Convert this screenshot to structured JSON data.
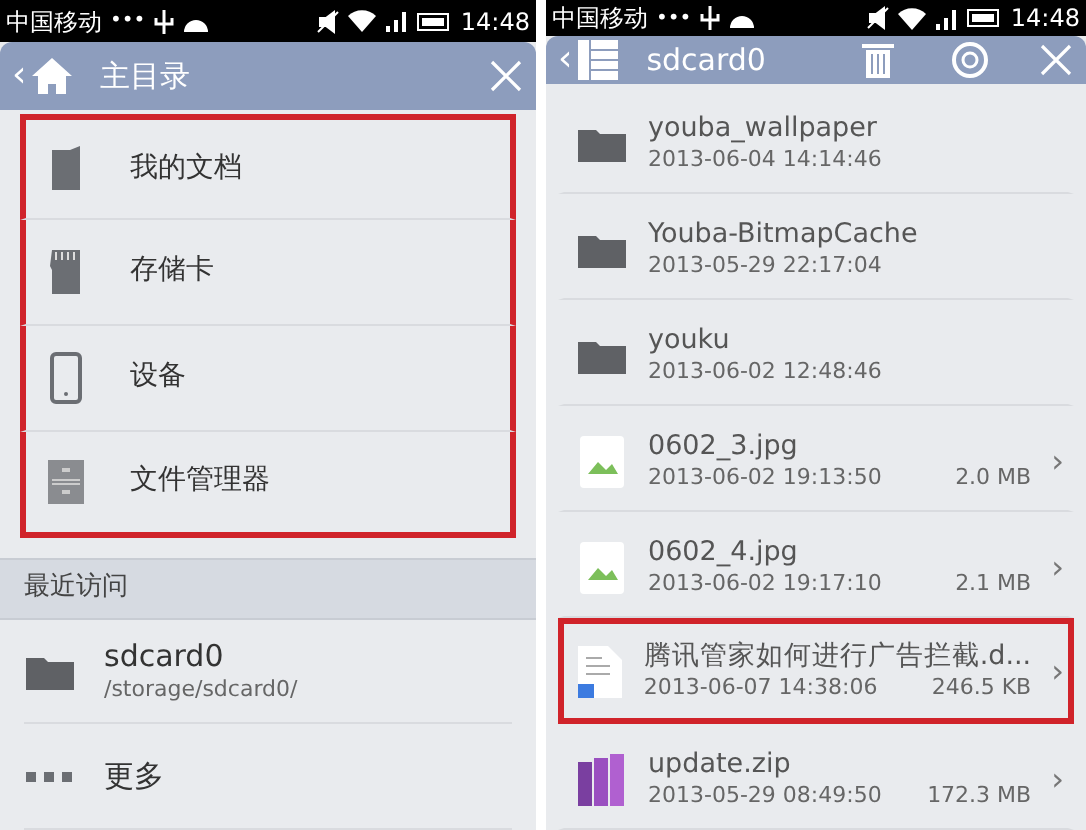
{
  "status_bars": [
    {
      "carrier": "中国移动",
      "dots": "•••",
      "time": "14:48"
    },
    {
      "carrier": "中国移动",
      "dots": "•••",
      "time": "14:48"
    }
  ],
  "left_panel": {
    "header": {
      "back": "‹",
      "title": "主目录"
    },
    "locations": [
      {
        "kind": "documents",
        "label": "我的文档",
        "highlighted": true
      },
      {
        "kind": "sdcard",
        "label": "存储卡",
        "highlighted": true
      },
      {
        "kind": "phone",
        "label": "设备",
        "highlighted": true
      },
      {
        "kind": "cabinet",
        "label": "文件管理器",
        "highlighted": true
      }
    ],
    "recent_section": {
      "title": "最近访问",
      "items": [
        {
          "kind": "folder",
          "name": "sdcard0",
          "path": "/storage/sdcard0/"
        },
        {
          "kind": "more",
          "name": "更多"
        }
      ]
    }
  },
  "right_panel": {
    "header": {
      "back": "‹",
      "title": "sdcard0"
    },
    "files": [
      {
        "kind": "folder",
        "name": "youba_wallpaper",
        "date": "2013-06-04 14:14:46",
        "highlighted": false
      },
      {
        "kind": "folder",
        "name": "Youba-BitmapCache",
        "date": "2013-05-29 22:17:04",
        "highlighted": false
      },
      {
        "kind": "folder",
        "name": "youku",
        "date": "2013-06-02 12:48:46",
        "highlighted": false
      },
      {
        "kind": "image",
        "name": "0602_3.jpg",
        "date": "2013-06-02 19:13:50",
        "size": "2.0 MB",
        "chevron": "›",
        "highlighted": false
      },
      {
        "kind": "image",
        "name": "0602_4.jpg",
        "date": "2013-06-02 19:17:10",
        "size": "2.1 MB",
        "chevron": "›",
        "highlighted": false
      },
      {
        "kind": "document",
        "name": "腾讯管家如何进行广告拦截.d...",
        "date": "2013-06-07 14:38:06",
        "size": "246.5 KB",
        "chevron": "›",
        "highlighted": true
      },
      {
        "kind": "archive",
        "name": "update.zip",
        "date": "2013-05-29 08:49:50",
        "size": "172.3 MB",
        "chevron": "›",
        "highlighted": false
      }
    ]
  }
}
